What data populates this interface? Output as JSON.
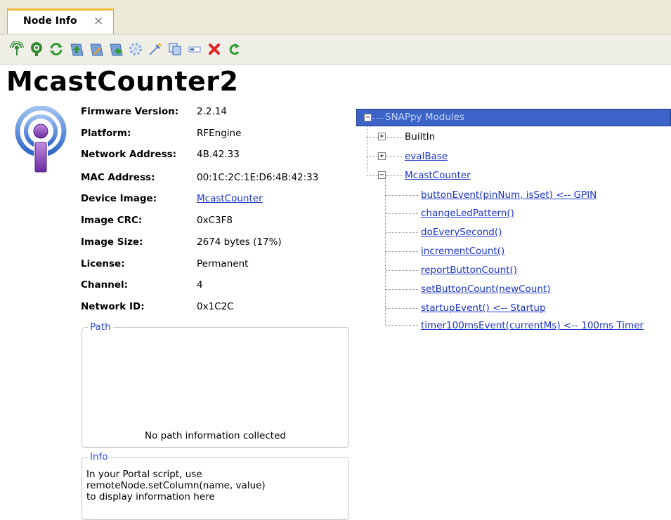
{
  "tab": {
    "label": "Node Info",
    "close_glyph": "×"
  },
  "toolbar": {
    "buttons": [
      {
        "icon": "ping-icon"
      },
      {
        "icon": "query-icon"
      },
      {
        "icon": "refresh-icon"
      },
      {
        "icon": "upload-script-icon"
      },
      {
        "icon": "edit-script-icon"
      },
      {
        "icon": "export-script-icon"
      },
      {
        "icon": "configure-icon"
      },
      {
        "icon": "probe-icon"
      },
      {
        "icon": "copy-icon"
      },
      {
        "icon": "field-icon"
      },
      {
        "icon": "delete-icon"
      },
      {
        "icon": "reboot-icon"
      }
    ]
  },
  "node": {
    "name": "McastCounter2",
    "icon": "wireless-node-icon",
    "properties": [
      {
        "label": "Firmware Version:",
        "value": "2.2.14"
      },
      {
        "label": "Platform:",
        "value": "RFEngine"
      },
      {
        "label": "Network Address:",
        "value": "4B.42.33"
      },
      {
        "label": "MAC Address:",
        "value": "00:1C:2C:1E:D6:4B:42:33"
      },
      {
        "label": "Device Image:",
        "value": "McastCounter"
      },
      {
        "label": "Image CRC:",
        "value": "0xC3F8"
      },
      {
        "label": "Image Size:",
        "value": "2674 bytes (17%)"
      },
      {
        "label": "License:",
        "value": "Permanent"
      },
      {
        "label": "Channel:",
        "value": "4"
      },
      {
        "label": "Network ID:",
        "value": "0x1C2C"
      }
    ]
  },
  "path_group": {
    "title": "Path",
    "message": "No path information collected"
  },
  "info_group": {
    "title": "Info",
    "lines": [
      "In your Portal script, use",
      "remoteNode.setColumn(name, value)",
      "to display information here"
    ]
  },
  "tree": {
    "root": "SNAPpy Modules",
    "modules": [
      {
        "name": "BuiltIn",
        "expander": "+"
      },
      {
        "name": "evalBase",
        "expander": "+"
      },
      {
        "name": "McastCounter",
        "expander": "-"
      }
    ],
    "functions": [
      "buttonEvent(pinNum, isSet) <-- GPIN",
      "changeLedPattern()",
      "doEverySecond()",
      "incrementCount()",
      "reportButtonCount()",
      "setButtonCount(newCount)",
      "startupEvent() <-- Startup",
      "timer100msEvent(currentMs) <-- 100ms Timer"
    ]
  }
}
